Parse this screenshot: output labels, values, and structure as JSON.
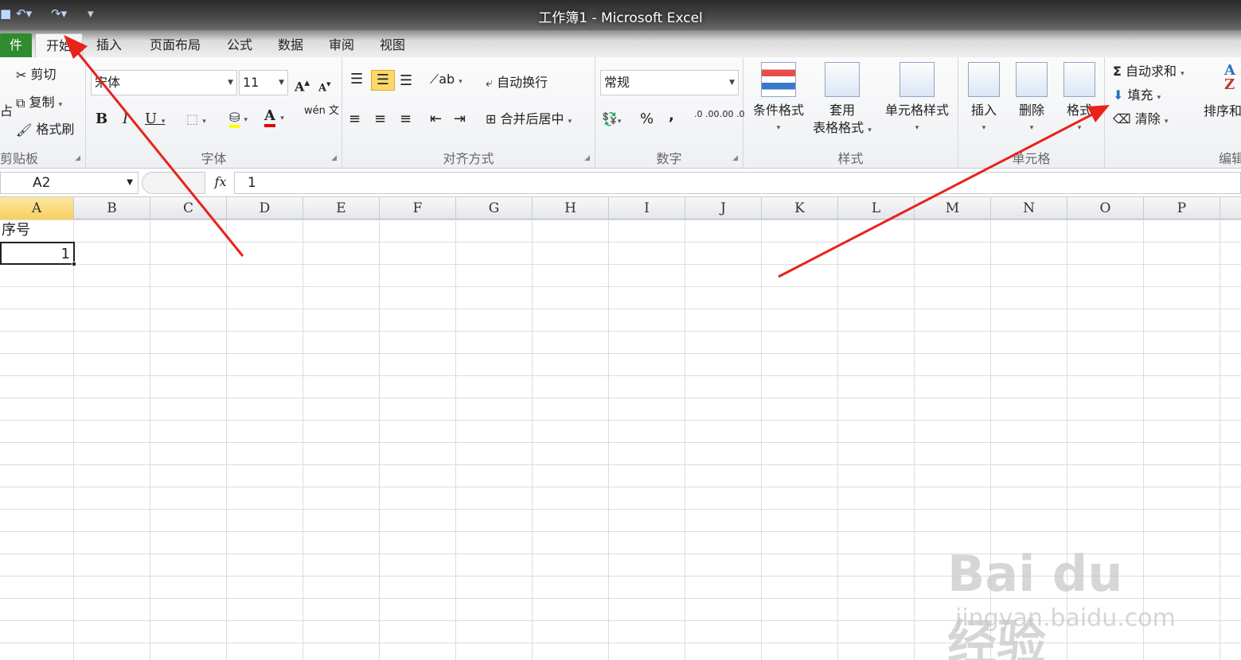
{
  "window": {
    "title": "工作簿1 - Microsoft Excel"
  },
  "tabs": [
    {
      "label": "件",
      "name": "tab-file"
    },
    {
      "label": "开始",
      "name": "tab-home"
    },
    {
      "label": "插入",
      "name": "tab-insert"
    },
    {
      "label": "页面布局",
      "name": "tab-page-layout"
    },
    {
      "label": "公式",
      "name": "tab-formulas"
    },
    {
      "label": "数据",
      "name": "tab-data"
    },
    {
      "label": "审阅",
      "name": "tab-review"
    },
    {
      "label": "视图",
      "name": "tab-view"
    }
  ],
  "ribbon": {
    "clipboard": {
      "label": "剪贴板",
      "paste_partial": "占",
      "cut": "剪切",
      "copy": "复制",
      "format_painter": "格式刷"
    },
    "font": {
      "label": "字体",
      "font_name": "宋体",
      "font_size": "11",
      "bold": "B",
      "italic": "I",
      "underline": "U",
      "grow": "A",
      "shrink": "A",
      "font_color_glyph": "A",
      "phonetic": "wén 文"
    },
    "alignment": {
      "label": "对齐方式",
      "wrap_text": "自动换行",
      "merge_center": "合并后居中"
    },
    "number": {
      "label": "数字",
      "format": "常规",
      "percent": "%",
      "comma": ",",
      "inc_decimal": ".0 .00",
      "dec_decimal": ".00 .0"
    },
    "styles": {
      "label": "样式",
      "conditional": "条件格式",
      "table_format_1": "套用",
      "table_format_2": "表格格式",
      "cell_styles": "单元格样式"
    },
    "cells": {
      "label": "单元格",
      "insert": "插入",
      "delete": "删除",
      "format": "格式"
    },
    "editing": {
      "label": "编辑",
      "autosum": "自动求和",
      "fill": "填充",
      "clear": "清除",
      "sort": "排序和"
    }
  },
  "formula_bar": {
    "name_box": "A2",
    "fx": "fx",
    "value": "1"
  },
  "columns": [
    "A",
    "B",
    "C",
    "D",
    "E",
    "F",
    "G",
    "H",
    "I",
    "J",
    "K",
    "L",
    "M",
    "N",
    "O",
    "P"
  ],
  "cells": {
    "a1": "序号",
    "a2": "1"
  },
  "watermark": {
    "brand": "Bai du 经验",
    "url": "jingyan.baidu.com"
  },
  "colors": {
    "file_tab": "#2e8b2e",
    "selection": "#f7cf5e",
    "arrow": "#e8231c"
  }
}
